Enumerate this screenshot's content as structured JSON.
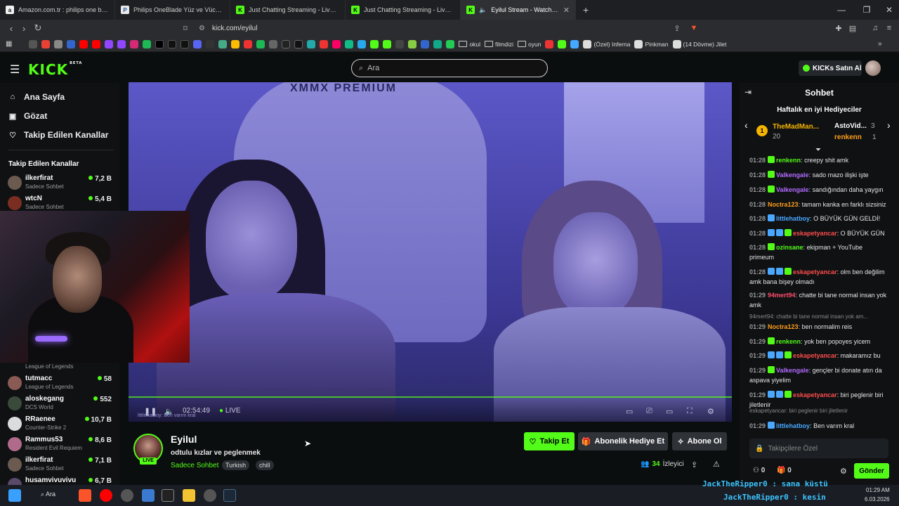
{
  "browser": {
    "tabs": [
      {
        "title": "Amazon.com.tr : philips one blade",
        "icon": "amazon-icon",
        "color": "#f0f0f0"
      },
      {
        "title": "Philips OneBlade Yüz ve Vücut için H",
        "icon": "philips-icon",
        "color": "#e8e8e8"
      },
      {
        "title": "Just Chatting Streaming - Live Stream",
        "icon": "kick-icon",
        "color": "#53fc18"
      },
      {
        "title": "Just Chatting Streaming - Live Stream",
        "icon": "kick-icon",
        "color": "#53fc18"
      },
      {
        "title": "Eyilul Stream - Watch Live on",
        "icon": "kick-icon",
        "color": "#53fc18"
      }
    ],
    "url": "kick.com/eyilul",
    "bookmarks": [
      "okul",
      "filmdizi",
      "oyun",
      "(Özel) Inferna",
      "Pinkman",
      "(14 Dövme) Jilet"
    ]
  },
  "header": {
    "logo": "KICK",
    "logo_beta": "BETA",
    "search_placeholder": "Ara",
    "buy_kicks": "KICKs Satın Al"
  },
  "sidebar": {
    "nav": [
      {
        "label": "Ana Sayfa",
        "icon": "home-icon"
      },
      {
        "label": "Gözat",
        "icon": "browse-icon"
      },
      {
        "label": "Takip Edilen Kanallar",
        "icon": "heart-icon"
      }
    ],
    "following_title": "Takip Edilen Kanallar",
    "channels": [
      {
        "name": "ilkerfirat",
        "category": "Sadece Sohbet",
        "viewers": "7,2 B",
        "color": "#6b5a4f"
      },
      {
        "name": "wtcN",
        "category": "Sadece Sohbet",
        "viewers": "5,4 B",
        "color": "#7a2e22"
      },
      {
        "name": "",
        "category": "League of Legends",
        "viewers": "",
        "color": "#444"
      },
      {
        "name": "tutmacc",
        "category": "League of Legends",
        "viewers": "58",
        "color": "#8a5a55"
      },
      {
        "name": "aloskegang",
        "category": "DCS World",
        "viewers": "552",
        "color": "#3a4a3a"
      },
      {
        "name": "RRaenee",
        "category": "Counter-Strike 2",
        "viewers": "10,7 B",
        "color": "#dcdcdc"
      },
      {
        "name": "Rammus53",
        "category": "Resident Evil Requiem",
        "viewers": "8,6 B",
        "color": "#b06a8a"
      },
      {
        "name": "ilkerfirat",
        "category": "Sadece Sohbet",
        "viewers": "7,1 B",
        "color": "#6b5a4f"
      },
      {
        "name": "husamvivuvivu",
        "category": "",
        "viewers": "6,7 B",
        "color": "#5a4a6a"
      }
    ]
  },
  "player": {
    "time": "02:54:49",
    "live": "LIVE",
    "overlay_caption": "littlehatboy: Ben varım kral",
    "watermark": "XMMX PREMIUM"
  },
  "stream": {
    "name": "Eyilul",
    "title": "odtulu kızlar ve peglenmek",
    "category": "Sadece Sohbet",
    "tags": [
      "Turkish",
      "chill"
    ],
    "live_badge": "LIVE",
    "viewers_count": "34",
    "viewers_label": "İzleyici",
    "follow": "Takip Et",
    "gift_sub": "Abonelik Hediye Et",
    "subscribe": "Abone Ol"
  },
  "chat": {
    "title": "Sohbet",
    "gifters_title": "Haftalık en iyi Hediyeciler",
    "gifters": [
      {
        "rank": "1",
        "name": "TheMadMan...",
        "count": "20"
      },
      {
        "name": "AstoVid...",
        "count": "3"
      },
      {
        "name": "renkenn",
        "count": "1"
      }
    ],
    "messages": [
      {
        "time": "01:28",
        "user": "renkenn",
        "color": "#53fc18",
        "text": "creepy shit amk"
      },
      {
        "time": "01:28",
        "user": "Valkengale",
        "color": "#b26bff",
        "text": "sado mazo ilişki işte"
      },
      {
        "time": "01:28",
        "user": "Valkengale",
        "color": "#b26bff",
        "text": "sandığından daha yaygın"
      },
      {
        "time": "01:28",
        "user": "Noctra123",
        "color": "#ff9f1a",
        "text": "tamam kanka en farklı sizsiniz"
      },
      {
        "time": "01:28",
        "user": "littlehatboy",
        "color": "#4aa8ff",
        "text": "O BÜYÜK GÜN GELDİ!"
      },
      {
        "time": "01:28",
        "user": "eskapetyancar",
        "color": "#ff4d4d",
        "text": "O BÜYÜK GÜN"
      },
      {
        "time": "01:28",
        "user": "ozinsane",
        "color": "#53fc18",
        "text": "ekipman + YouTube primeum"
      },
      {
        "time": "01:28",
        "user": "eskapetyancar",
        "color": "#ff4d4d",
        "text": "olm ben değilim amk bana bişey olmadı"
      },
      {
        "time": "01:29",
        "user": "94mert94",
        "color": "#ff4d6d",
        "text": "chatte bi tane normal insan yok amk"
      },
      {
        "time": "01:29",
        "user": "Noctra123",
        "color": "#ff9f1a",
        "text": "ben normalim reis"
      },
      {
        "time": "01:29",
        "user": "renkenn",
        "color": "#53fc18",
        "text": "yok ben popoyes yicem"
      },
      {
        "time": "01:29",
        "user": "eskapetyancar",
        "color": "#ff4d4d",
        "text": "makaramız bu"
      },
      {
        "time": "01:29",
        "user": "Valkengale",
        "color": "#b26bff",
        "text": "gençler bi donate atın da aspava yiyelim"
      },
      {
        "time": "01:29",
        "user": "eskapetyancar",
        "color": "#ff4d4d",
        "text": "biri peglenir biri jiletlenir"
      },
      {
        "time": "01:29",
        "user": "littlehatboy",
        "color": "#4aa8ff",
        "text": "Ben varım kral"
      }
    ],
    "replies": [
      "94mert94: chatte bi tane normal insan yok am...",
      "eskapetyancar: biri peglenir biri jiletlenir"
    ],
    "input_placeholder": "Takipçilere Özel",
    "kicks_count": "0",
    "gift_count": "0",
    "send": "Gönder"
  },
  "taskbar": {
    "search": "Ara",
    "time": "01:29 AM",
    "date": "6.03.2026",
    "overlay_lines": [
      "JackTheRipper0 : sana küstü",
      "JackTheRipper0 : kesin"
    ]
  }
}
